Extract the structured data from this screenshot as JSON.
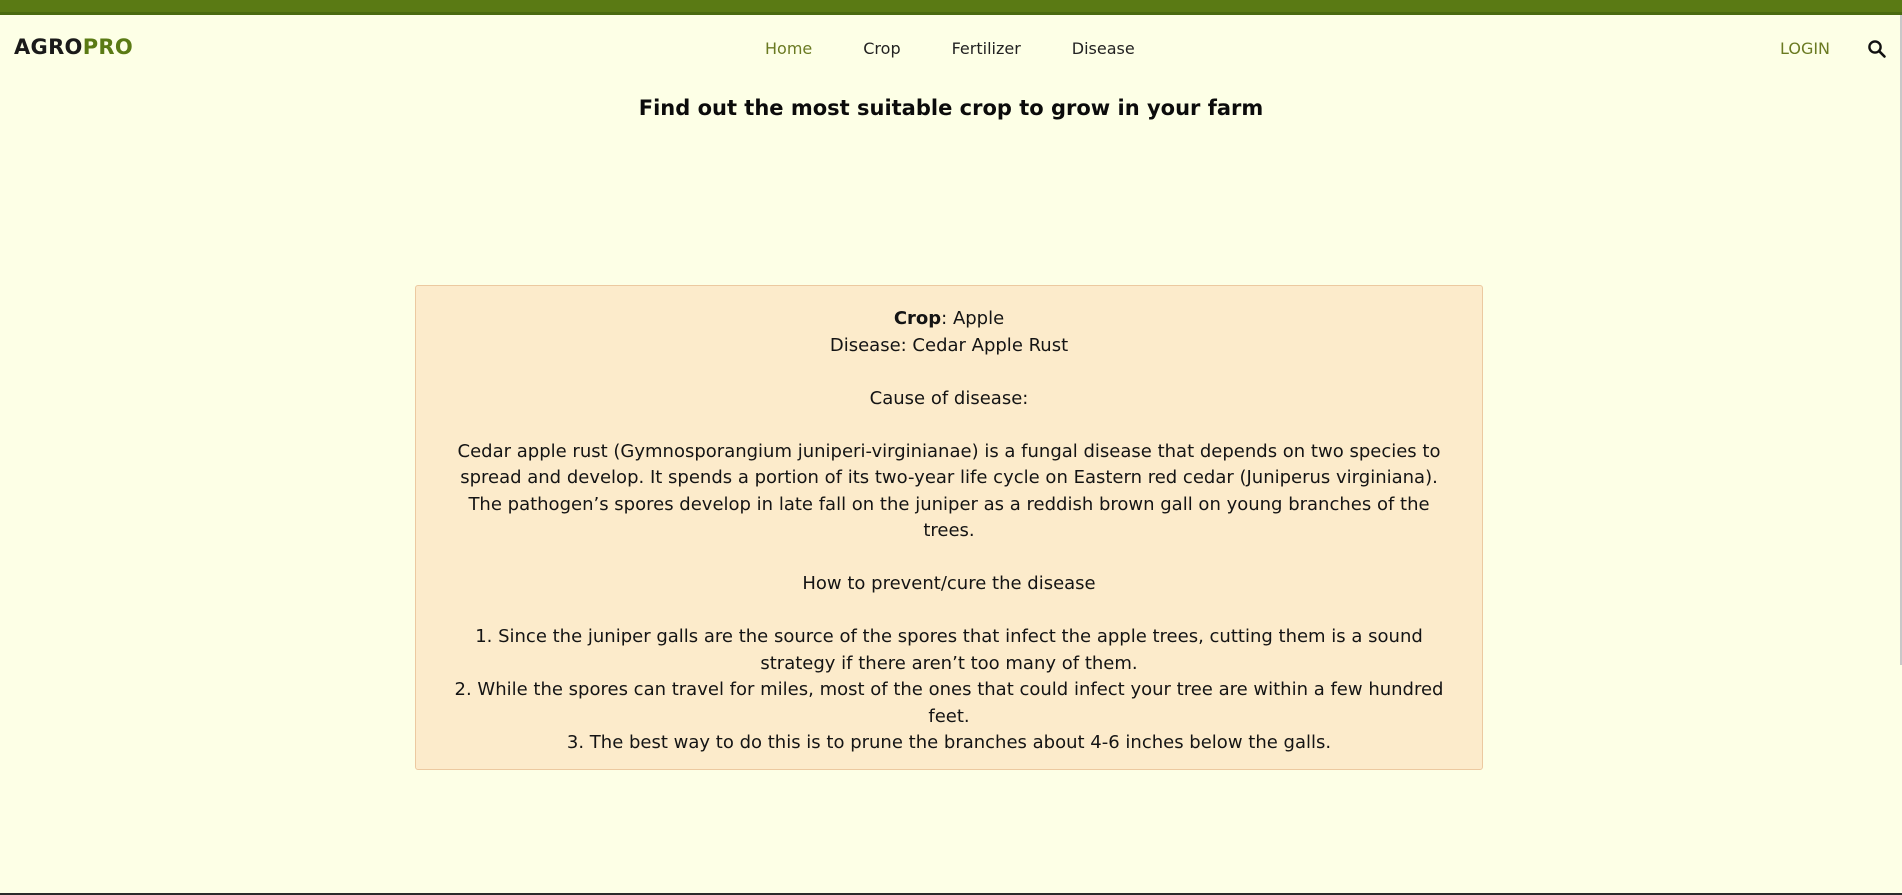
{
  "brand": {
    "part1": "AGRO",
    "part2": "PRO"
  },
  "nav": {
    "items": [
      "Home",
      "Crop",
      "Fertilizer",
      "Disease"
    ],
    "login": "LOGIN"
  },
  "page": {
    "title": "Find out the most suitable crop to grow in your farm"
  },
  "result": {
    "crop_label": "Crop",
    "crop_value": ": Apple",
    "disease_line": "Disease: Cedar Apple Rust",
    "cause_heading": "Cause of disease:",
    "cause_text": "Cedar apple rust (Gymnosporangium juniperi-virginianae) is a fungal disease that depends on two species to spread and develop. It spends a portion of its two-year life cycle on Eastern red cedar (Juniperus virginiana). The pathogen’s spores develop in late fall on the juniper as a reddish brown gall on young branches of the trees.",
    "prevent_heading": "How to prevent/cure the disease",
    "steps": [
      "1. Since the juniper galls are the source of the spores that infect the apple trees, cutting them is a sound strategy if there aren’t too many of them.",
      "2. While the spores can travel for miles, most of the ones that could infect your tree are within a few hundred feet.",
      "3. The best way to do this is to prune the branches about 4-6 inches below the galls."
    ]
  },
  "colors": {
    "background": "#fdffe6",
    "accent": "#5a7a14",
    "card_background": "#fcebcb"
  },
  "icons": {
    "search": "search-icon"
  }
}
